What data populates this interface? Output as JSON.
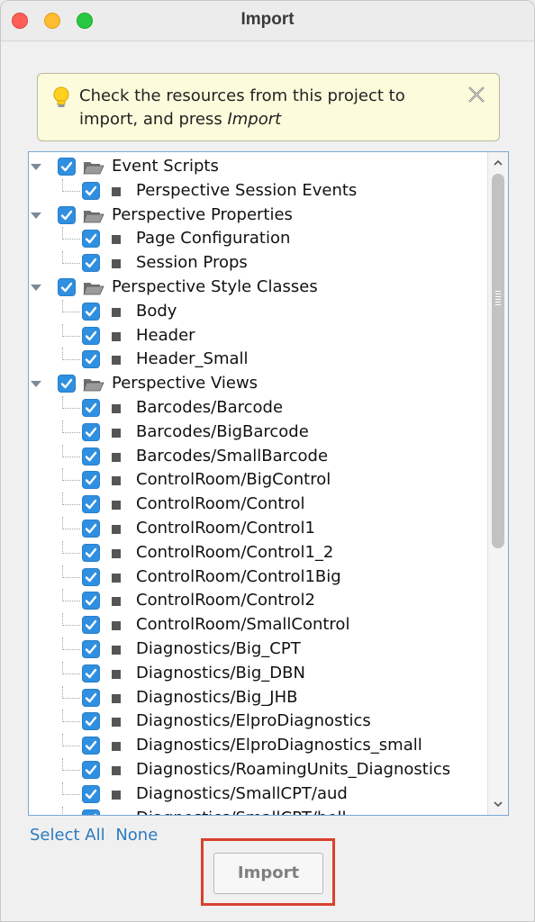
{
  "window": {
    "title": "Import"
  },
  "hint": {
    "text": "Check the resources from this project to import, and press ",
    "emphasis": "Import"
  },
  "tree": {
    "groups": [
      {
        "label": "Event Scripts",
        "items": [
          "Perspective Session Events"
        ]
      },
      {
        "label": "Perspective Properties",
        "items": [
          "Page Configuration",
          "Session Props"
        ]
      },
      {
        "label": "Perspective Style Classes",
        "items": [
          "Body",
          "Header",
          "Header_Small"
        ]
      },
      {
        "label": "Perspective Views",
        "items": [
          "Barcodes/Barcode",
          "Barcodes/BigBarcode",
          "Barcodes/SmallBarcode",
          "ControlRoom/BigControl",
          "ControlRoom/Control",
          "ControlRoom/Control1",
          "ControlRoom/Control1_2",
          "ControlRoom/Control1Big",
          "ControlRoom/Control2",
          "ControlRoom/SmallControl",
          "Diagnostics/Big_CPT",
          "Diagnostics/Big_DBN",
          "Diagnostics/Big_JHB",
          "Diagnostics/ElproDiagnostics",
          "Diagnostics/ElproDiagnostics_small",
          "Diagnostics/RoamingUnits_Diagnostics",
          "Diagnostics/SmallCPT/aud",
          "Diagnostics/SmallCPT/bell"
        ]
      }
    ]
  },
  "links": {
    "select_all": "Select All",
    "none": "None"
  },
  "buttons": {
    "import": "Import"
  },
  "colors": {
    "checkbox": "#2f8fe0",
    "link": "#2b7bbf",
    "focus_outline": "#d9412e"
  }
}
